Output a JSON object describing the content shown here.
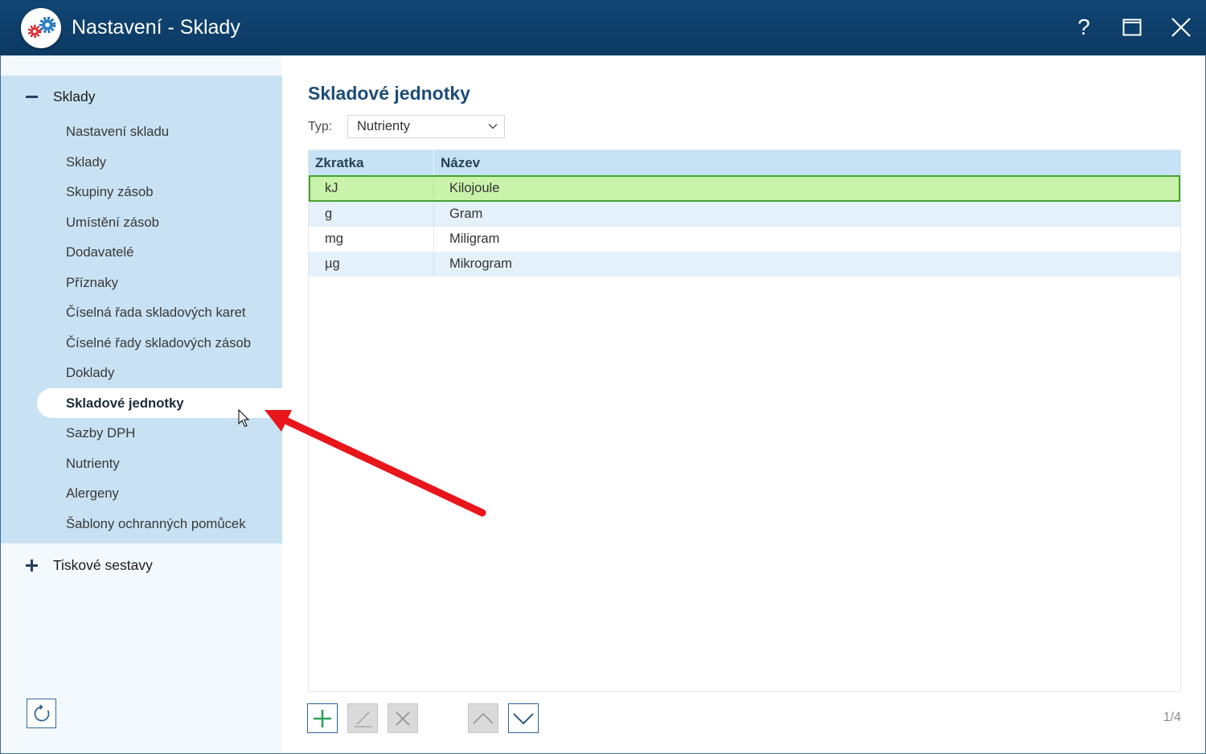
{
  "window": {
    "title": "Nastavení - Sklady",
    "logo_icon": "settings-gears-icon",
    "controls": {
      "help_label": "?",
      "maximize_icon": "maximize-icon",
      "close_icon": "close-icon"
    }
  },
  "sidebar": {
    "groups": [
      {
        "label": "Sklady",
        "expanded": true,
        "toggle_icon": "collapse-minus-icon",
        "items": [
          "Nastavení skladu",
          "Sklady",
          "Skupiny zásob",
          "Umístění zásob",
          "Dodavatelé",
          "Příznaky",
          "Číselná řada skladových karet",
          "Číselné řady skladových zásob",
          "Doklady",
          "Skladové jednotky",
          "Sazby DPH",
          "Nutrienty",
          "Alergeny",
          "Šablony ochranných pomůcek"
        ],
        "selected_index": 9
      },
      {
        "label": "Tiskové sestavy",
        "expanded": false,
        "toggle_icon": "expand-plus-icon"
      }
    ],
    "refresh_icon": "refresh-icon"
  },
  "main": {
    "heading": "Skladové jednotky",
    "type_filter": {
      "label": "Typ:",
      "value": "Nutrienty",
      "icon": "chevron-down-icon"
    },
    "table": {
      "columns": [
        "Zkratka",
        "Název"
      ],
      "rows": [
        {
          "abbreviation": "kJ",
          "name": "Kilojoule",
          "selected": true
        },
        {
          "abbreviation": "g",
          "name": "Gram",
          "selected": false
        },
        {
          "abbreviation": "mg",
          "name": "Miligram",
          "selected": false
        },
        {
          "abbreviation": "µg",
          "name": "Mikrogram",
          "selected": false
        }
      ]
    },
    "toolbar": {
      "buttons": [
        {
          "icon": "add-plus-icon",
          "enabled": true
        },
        {
          "icon": "edit-pencil-icon",
          "enabled": false
        },
        {
          "icon": "delete-x-icon",
          "enabled": false
        },
        {
          "icon": "move-up-chevron-icon",
          "enabled": false
        },
        {
          "icon": "move-down-chevron-icon",
          "enabled": true
        }
      ]
    },
    "pager": "1/4"
  },
  "overlay": {
    "annotation_icon": "red-arrow-annotation",
    "cursor_icon": "mouse-pointer-icon"
  },
  "colors": {
    "title_bar": "#0c3a63",
    "heading": "#1d4d79",
    "sidebar_group_bg": "#c8e2f3",
    "table_header_bg": "#c6e2f4",
    "alt_row_bg": "#e5f1fa",
    "selected_row_bg": "#c9f2aa",
    "selected_row_border": "#47a130",
    "add_icon": "#2aa25a",
    "annotation_arrow": "#e8151b"
  }
}
